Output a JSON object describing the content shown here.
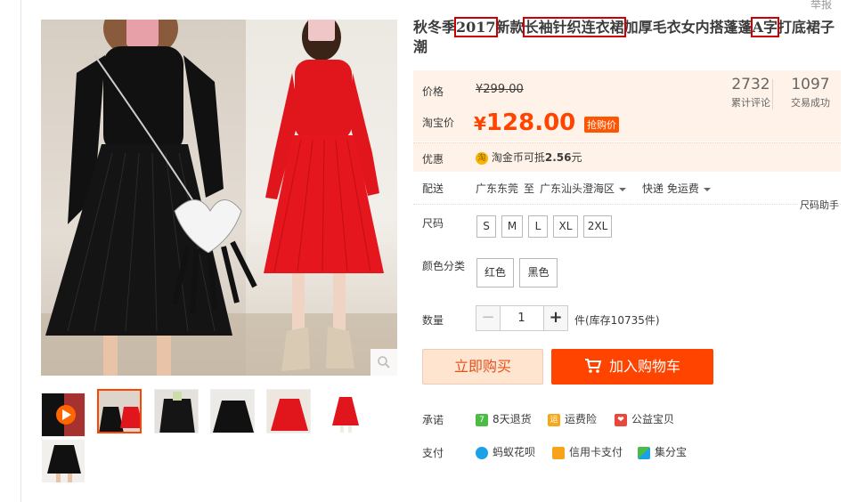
{
  "report_label": "举报",
  "title": {
    "p1": "秋冬季",
    "h1": "2017",
    "p2": "新款",
    "h2": "长袖针织连衣裙",
    "p3": "加厚毛衣女内搭蓬蓬",
    "h3": "A字",
    "p4": "打底裙子潮"
  },
  "price": {
    "label": "价格",
    "old": "¥299.00",
    "tb_label": "淘宝价",
    "currency": "¥",
    "new": "128.00",
    "badge": "抢购价"
  },
  "stats": [
    {
      "num": "2732",
      "label": "累计评论"
    },
    {
      "num": "1097",
      "label": "交易成功"
    }
  ],
  "promo": {
    "label": "优惠",
    "icon": "淘",
    "text": "淘金币可抵",
    "amount": "2.56",
    "unit": "元"
  },
  "delivery": {
    "label": "配送",
    "from": "广东东莞",
    "to_word": "至",
    "to": "广东汕头澄海区",
    "method": "快递 免运费"
  },
  "size_help": "尺码助手",
  "size": {
    "label": "尺码",
    "options": [
      "S",
      "M",
      "L",
      "XL",
      "2XL"
    ]
  },
  "color": {
    "label": "颜色分类",
    "options": [
      "红色",
      "黑色"
    ]
  },
  "quantity": {
    "label": "数量",
    "minus": "−",
    "value": "1",
    "plus": "+",
    "stock": "件(库存10735件)"
  },
  "buttons": {
    "buy": "立即购买",
    "cart": "加入购物车"
  },
  "promise": {
    "label": "承诺",
    "items": [
      "8天退货",
      "运费险",
      "公益宝贝"
    ],
    "icons": [
      "7",
      "运",
      "❤"
    ]
  },
  "payment": {
    "label": "支付",
    "items": [
      "蚂蚁花呗",
      "信用卡支付",
      "集分宝"
    ]
  },
  "colors": {
    "accent": "#ff4400",
    "price_bg": "#fff2e8",
    "highlight_box": "#cc0000"
  }
}
